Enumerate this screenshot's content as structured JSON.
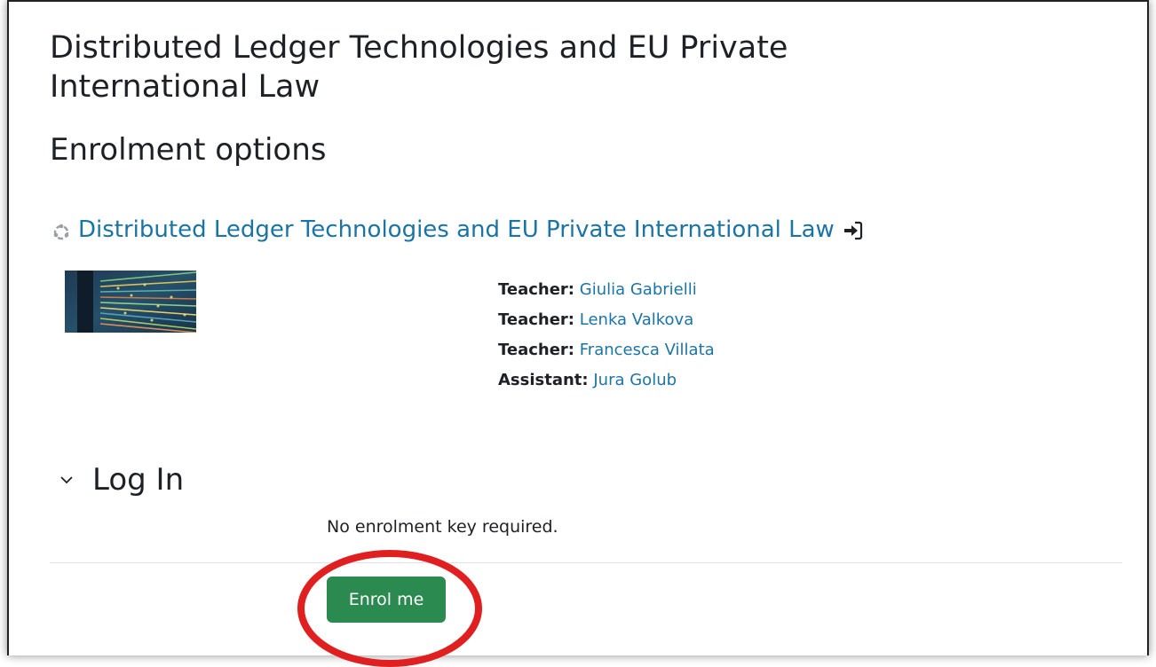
{
  "course": {
    "title": "Distributed Ledger Technologies and EU Private International Law",
    "link_text": "Distributed Ledger Technologies and EU Private International Law",
    "course_icon": "course-hub-icon",
    "guest_icon": "sign-in-icon"
  },
  "page": {
    "heading": "Enrolment options"
  },
  "contacts": [
    {
      "role": "Teacher:",
      "name": "Giulia Gabrielli"
    },
    {
      "role": "Teacher:",
      "name": "Lenka Valkova"
    },
    {
      "role": "Teacher:",
      "name": "Francesca Villata"
    },
    {
      "role": "Assistant:",
      "name": "Jura Golub"
    }
  ],
  "login_section": {
    "title": "Log In",
    "chevron_icon": "chevron-down-icon",
    "note": "No enrolment key required.",
    "button_label": "Enrol me",
    "button_color": "#2b8a4f"
  },
  "annotation": {
    "highlight_color": "#e02020"
  },
  "colors": {
    "link": "#1a74a6",
    "text": "#1d2125"
  }
}
